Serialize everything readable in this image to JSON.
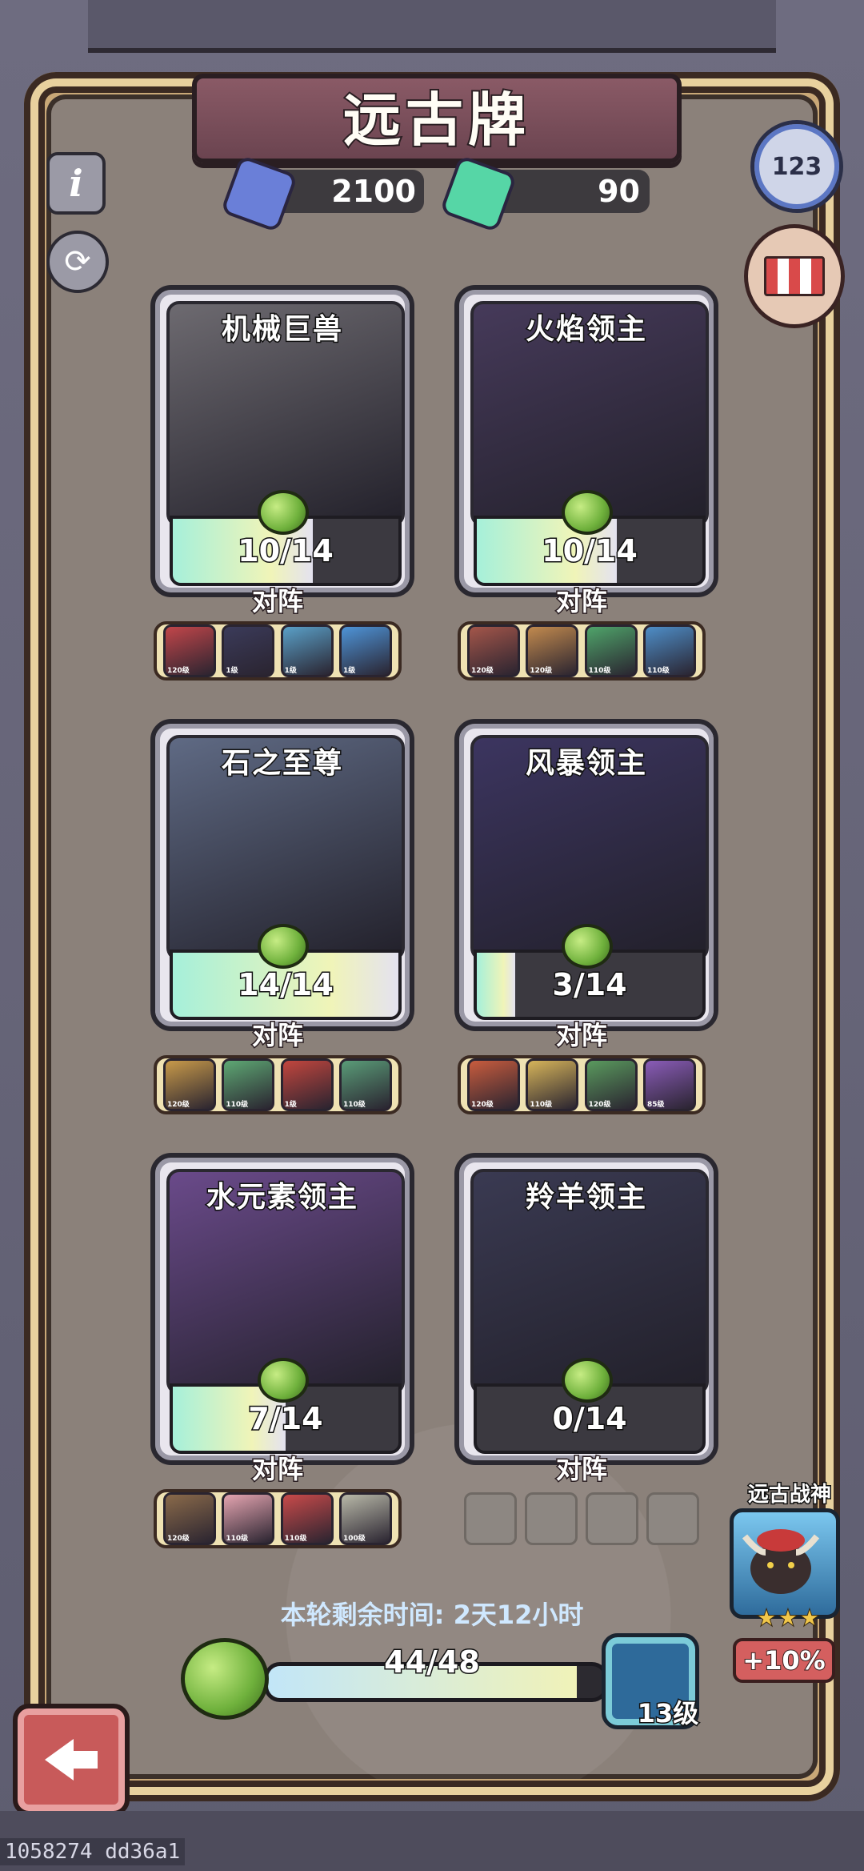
{
  "title": "远古牌",
  "currencies": [
    {
      "name": "blue-crystal",
      "value": "2100",
      "color": "#6a7fd8"
    },
    {
      "name": "green-crystal",
      "value": "90",
      "color": "#56d6a6"
    }
  ],
  "cards": [
    {
      "name": "机械巨兽",
      "progress": "10/14",
      "fill": 0.62,
      "art_color": "#6d6a70",
      "lineup_label": "对阵",
      "lineup": [
        {
          "level": "120级",
          "color": "#c2464a"
        },
        {
          "level": "1级",
          "color": "#3b3b5a"
        },
        {
          "level": "1级",
          "color": "#5aa0c8"
        },
        {
          "level": "1级",
          "color": "#4e94d8"
        }
      ]
    },
    {
      "name": "火焰领主",
      "progress": "10/14",
      "fill": 0.62,
      "art_color": "#463a5a",
      "lineup_label": "对阵",
      "lineup": [
        {
          "level": "120级",
          "color": "#a4564a"
        },
        {
          "level": "120级",
          "color": "#c28a4e"
        },
        {
          "level": "110级",
          "color": "#4fa46a"
        },
        {
          "level": "110级",
          "color": "#4e8ec8"
        }
      ]
    },
    {
      "name": "石之至尊",
      "progress": "14/14",
      "fill": 1.0,
      "art_color": "#5f6a84",
      "lineup_label": "对阵",
      "lineup": [
        {
          "level": "120级",
          "color": "#c89a4a"
        },
        {
          "level": "110级",
          "color": "#5ea874"
        },
        {
          "level": "1级",
          "color": "#c2463e"
        },
        {
          "level": "110级",
          "color": "#5a9c78"
        }
      ]
    },
    {
      "name": "风暴领主",
      "progress": "3/14",
      "fill": 0.17,
      "art_color": "#3c3560",
      "lineup_label": "对阵",
      "lineup": [
        {
          "level": "120级",
          "color": "#c85c3e"
        },
        {
          "level": "110级",
          "color": "#d6b45a"
        },
        {
          "level": "120级",
          "color": "#5a9a5e"
        },
        {
          "level": "85级",
          "color": "#8a5cb8"
        }
      ]
    },
    {
      "name": "水元素领主",
      "progress": "7/14",
      "fill": 0.5,
      "art_color": "#6a4a8a",
      "lineup_label": "对阵",
      "lineup": [
        {
          "level": "120级",
          "color": "#8a6a4a"
        },
        {
          "level": "110级",
          "color": "#e4a4b0"
        },
        {
          "level": "110级",
          "color": "#c84a4a"
        },
        {
          "level": "100级",
          "color": "#b8b8a8"
        }
      ]
    },
    {
      "name": "羚羊领主",
      "progress": "0/14",
      "fill": 0.0,
      "art_color": "#3a3a52",
      "lineup_label": "对阵",
      "lineup": []
    }
  ],
  "timer": "本轮剩余时间: 2天12小时",
  "bottom_progress": {
    "text": "44/48",
    "fraction": 0.9167
  },
  "chest_level": "13级",
  "war_god": {
    "label": "远古战神",
    "stars": "★★★",
    "bonus": "+10%"
  },
  "footer_id": "1058274 dd36a1",
  "icons": {
    "info": "i",
    "refresh": "⟳",
    "rank": "123",
    "back": "back-arrow-icon"
  }
}
